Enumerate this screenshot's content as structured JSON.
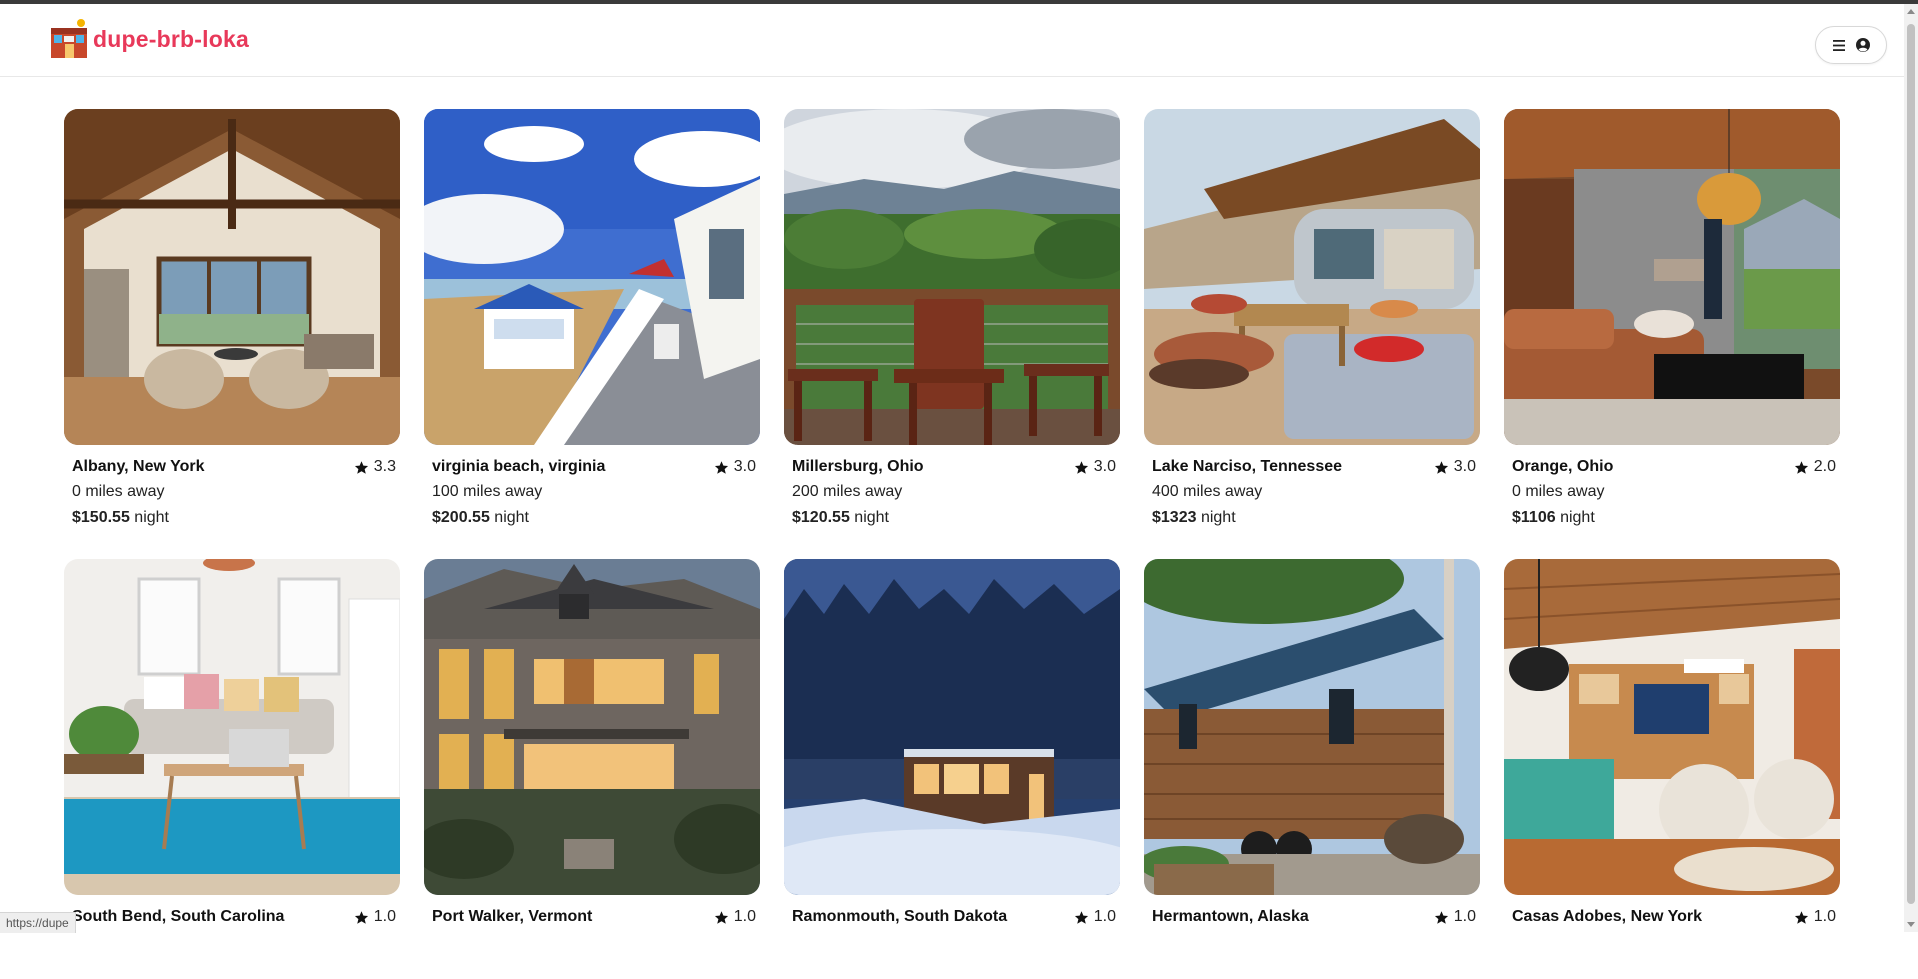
{
  "header": {
    "brand": "dupe-brb-loka",
    "menu_icon": "hamburger-icon",
    "user_icon": "user-circle-icon",
    "brand_color": "#e8395a"
  },
  "listings": [
    {
      "location": "Albany, New York",
      "rating": "3.3",
      "distance": "0 miles away",
      "price": "$150.55",
      "unit": "night",
      "photo": "timber-frame-living-room"
    },
    {
      "location": "virginia beach, virginia",
      "rating": "3.0",
      "distance": "100 miles away",
      "price": "$200.55",
      "unit": "night",
      "photo": "beach-deck-gazebo"
    },
    {
      "location": "Millersburg, Ohio",
      "rating": "3.0",
      "distance": "200 miles away",
      "price": "$120.55",
      "unit": "night",
      "photo": "mountain-view-deck-chairs"
    },
    {
      "location": "Lake Narciso, Tennessee",
      "rating": "3.0",
      "distance": "400 miles away",
      "price": "$1323",
      "unit": "night",
      "photo": "airstream-patio-cushions"
    },
    {
      "location": "Orange, Ohio",
      "rating": "2.0",
      "distance": "0 miles away",
      "price": "$1106",
      "unit": "night",
      "photo": "modern-lake-lounge"
    },
    {
      "location": "South Bend, South Carolina",
      "rating": "1.0",
      "distance": "",
      "price": "",
      "unit": "",
      "photo": "white-room-blue-rug"
    },
    {
      "location": "Port Walker, Vermont",
      "rating": "1.0",
      "distance": "",
      "price": "",
      "unit": "",
      "photo": "victorian-house-dusk"
    },
    {
      "location": "Ramonmouth, South Dakota",
      "rating": "1.0",
      "distance": "",
      "price": "",
      "unit": "",
      "photo": "snowy-cabin-night"
    },
    {
      "location": "Hermantown, Alaska",
      "rating": "1.0",
      "distance": "",
      "price": "",
      "unit": "",
      "photo": "wooden-tiny-house"
    },
    {
      "location": "Casas Adobes, New York",
      "rating": "1.0",
      "distance": "",
      "price": "",
      "unit": "",
      "photo": "wood-ceiling-living-room"
    }
  ],
  "status_bar": {
    "url": "https://dupe"
  }
}
